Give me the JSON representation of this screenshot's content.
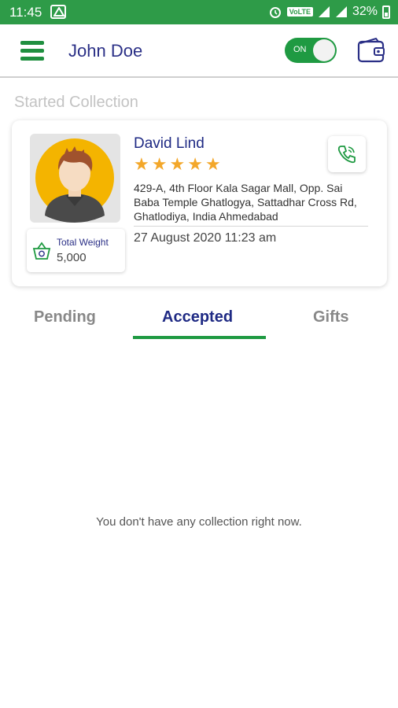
{
  "status_bar": {
    "time": "11:45",
    "volte": "VoLTE",
    "battery": "32%"
  },
  "app_bar": {
    "user_name": "John Doe",
    "toggle_label": "ON"
  },
  "section_title": "Started Collection",
  "collection": {
    "name": "David Lind",
    "rating": 5,
    "address": "429-A, 4th Floor Kala Sagar Mall,  Opp. Sai Baba Temple Ghatlogya,  Sattadhar Cross Rd,  Ghatlodiya,  India Ahmedabad",
    "datetime": "27 August 2020 11:23 am",
    "weight_label": "Total Weight",
    "weight_value": "5,000"
  },
  "tabs": [
    {
      "label": "Pending",
      "active": false
    },
    {
      "label": "Accepted",
      "active": true
    },
    {
      "label": "Gifts",
      "active": false
    }
  ],
  "empty_message": "You don't have any collection right now.",
  "colors": {
    "status_bar": "#2e9b48",
    "accent_green": "#1f9a42",
    "title_blue": "#1f2a84",
    "star": "#f3a72a"
  }
}
